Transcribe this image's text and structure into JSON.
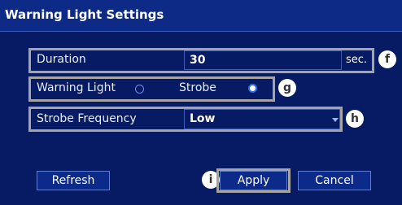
{
  "window": {
    "title": "Warning Light Settings"
  },
  "duration": {
    "label": "Duration",
    "value": "30",
    "unit": "sec.",
    "callout": "f"
  },
  "warning_light": {
    "label": "Warning Light",
    "strobe_label": "Strobe",
    "selected": "Strobe",
    "callout": "g"
  },
  "strobe_frequency": {
    "label": "Strobe Frequency",
    "value": "Low",
    "callout": "h"
  },
  "buttons": {
    "refresh": "Refresh",
    "apply": "Apply",
    "cancel": "Cancel",
    "apply_callout": "i"
  },
  "colors": {
    "background": "#071a64",
    "titlebar": "#0d2a86",
    "callout_frame": "#a4a4a4",
    "selected_radio": "#2f6cf0"
  }
}
